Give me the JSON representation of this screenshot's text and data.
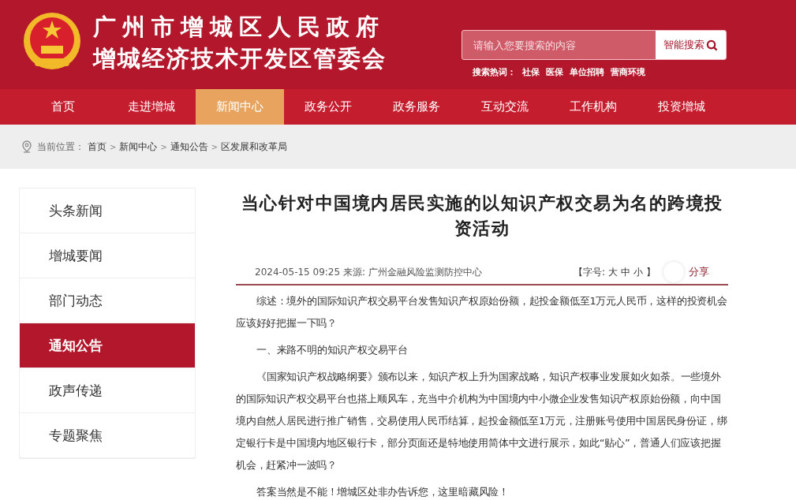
{
  "header": {
    "title_line_1": "广州市增城区人民政府",
    "title_line_2": "增城经济技术开发区管委会",
    "search": {
      "placeholder": "请输入您要搜索的内容",
      "button": "智能搜索"
    },
    "hot_words": {
      "label": "搜索热词：",
      "items": [
        "社保",
        "医保",
        "单位招聘",
        "营商环境"
      ]
    }
  },
  "nav": [
    {
      "label": "首页",
      "selected": false
    },
    {
      "label": "走进增城",
      "selected": false
    },
    {
      "label": "新闻中心",
      "selected": true
    },
    {
      "label": "政务公开",
      "selected": false
    },
    {
      "label": "政务服务",
      "selected": false
    },
    {
      "label": "互动交流",
      "selected": false
    },
    {
      "label": "工作机构",
      "selected": false
    },
    {
      "label": "投资增城",
      "selected": false
    }
  ],
  "breadcrumb": {
    "label": "当前位置：",
    "items": [
      "首页",
      "新闻中心",
      "通知公告",
      "区发展和改革局"
    ],
    "separator": ">"
  },
  "sidebar": {
    "items": [
      {
        "label": "头条新闻",
        "selected": false
      },
      {
        "label": "增城要闻",
        "selected": false
      },
      {
        "label": "部门动态",
        "selected": false
      },
      {
        "label": "通知公告",
        "selected": true
      },
      {
        "label": "政声传递",
        "selected": false
      },
      {
        "label": "专题聚焦",
        "selected": false
      }
    ]
  },
  "article": {
    "title": "当心针对中国境内居民实施的以知识产权交易为名的跨境投资活动",
    "meta": "2024-05-15 09:25 来源: 广州金融风险监测防控中心",
    "font_size": {
      "label": "【字号:",
      "options": [
        "大",
        "中",
        "小"
      ],
      "close": "】"
    },
    "share": "分享",
    "paragraphs": [
      "综述：境外的国际知识产权交易平台发售知识产权原始份额，起投金额低至1万元人民币，这样的投资机会应该好好把握一下吗？",
      "一、来路不明的知识产权交易平台",
      "《国家知识产权战略纲要》颁布以来，知识产权上升为国家战略，知识产权事业发展如火如荼。一些境外的国际知识产权交易平台也搭上顺风车，充当中介机构为中国境内中小微企业发售知识产权原始份额，向中国境内自然人居民进行推广销售，交易使用人民币结算，起投金额低至1万元，注册账号使用中国居民身份证，绑定银行卡是中国境内地区银行卡，部分页面还是特地使用简体中文进行展示，如此“贴心”，普通人们应该把握机会，赶紧冲一波吗？",
      "答案当然是不能！增城区处非办告诉您，这里暗藏风险！"
    ]
  }
}
